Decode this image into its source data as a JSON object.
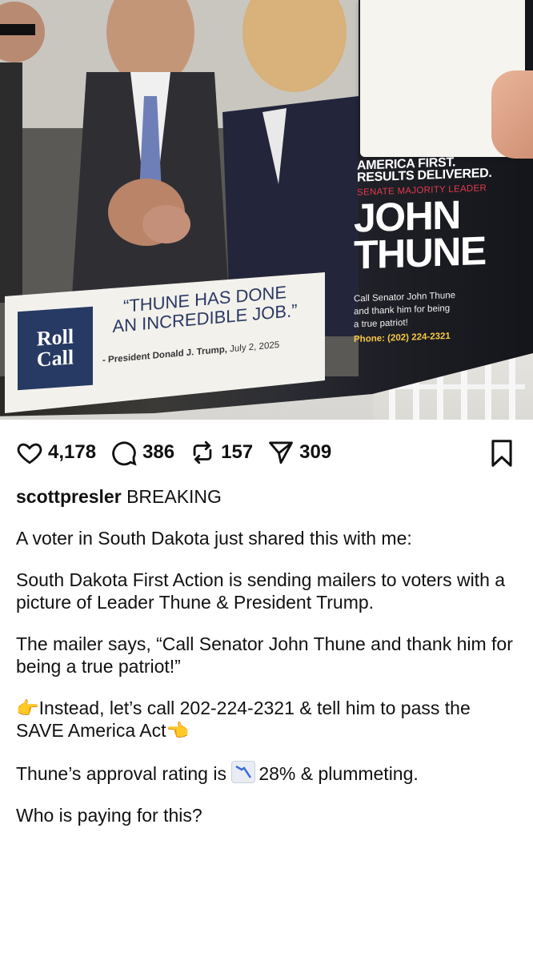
{
  "post": {
    "image": {
      "headline_line1": "AMERICA FIRST.",
      "headline_line2": "RESULTS DELIVERED.",
      "subhead": "SENATE MAJORITY LEADER",
      "name_line1": "JOHN",
      "name_line2": "THUNE",
      "callout_line1": "Call Senator John Thune",
      "callout_line2": "and thank him for being",
      "callout_line3": "a true patriot!",
      "phone": "Phone: (202) 224-2321",
      "brand_line1": "Roll",
      "brand_line2": "Call",
      "quote_line1": "“THUNE HAS DONE",
      "quote_line2": "AN INCREDIBLE JOB.”",
      "attribution_name": "- President Donald J. Trump,",
      "attribution_date": "July 2, 2025"
    },
    "actions": {
      "likes": "4,178",
      "comments": "386",
      "reposts": "157",
      "shares": "309"
    },
    "username": "scottpresler",
    "caption_first": "BREAKING",
    "paragraphs": [
      "A voter in South Dakota just shared this with me:",
      "South Dakota First Action is sending mailers to voters with a picture of Leader Thune & President Trump.",
      "The mailer says, “Call Senator John Thune and thank him for being a true patriot!”",
      "👉Instead, let’s call 202-224-2321 & tell him to pass the SAVE America Act👈"
    ],
    "approval_prefix": "Thune’s approval rating is ",
    "approval_suffix": "28% & plummeting.",
    "last_paragraph": "Who is paying for this?"
  },
  "icons": {
    "like": "heart-icon",
    "comment": "comment-bubble-icon",
    "repost": "repost-icon",
    "share": "send-icon",
    "save": "bookmark-icon",
    "chart_emoji": "chart-decreasing-icon"
  },
  "colors": {
    "quote_blue": "#2b3a63",
    "brand_box": "#273a63",
    "subhead_red": "#e23a4d",
    "phone_yellow": "#f6c844"
  }
}
